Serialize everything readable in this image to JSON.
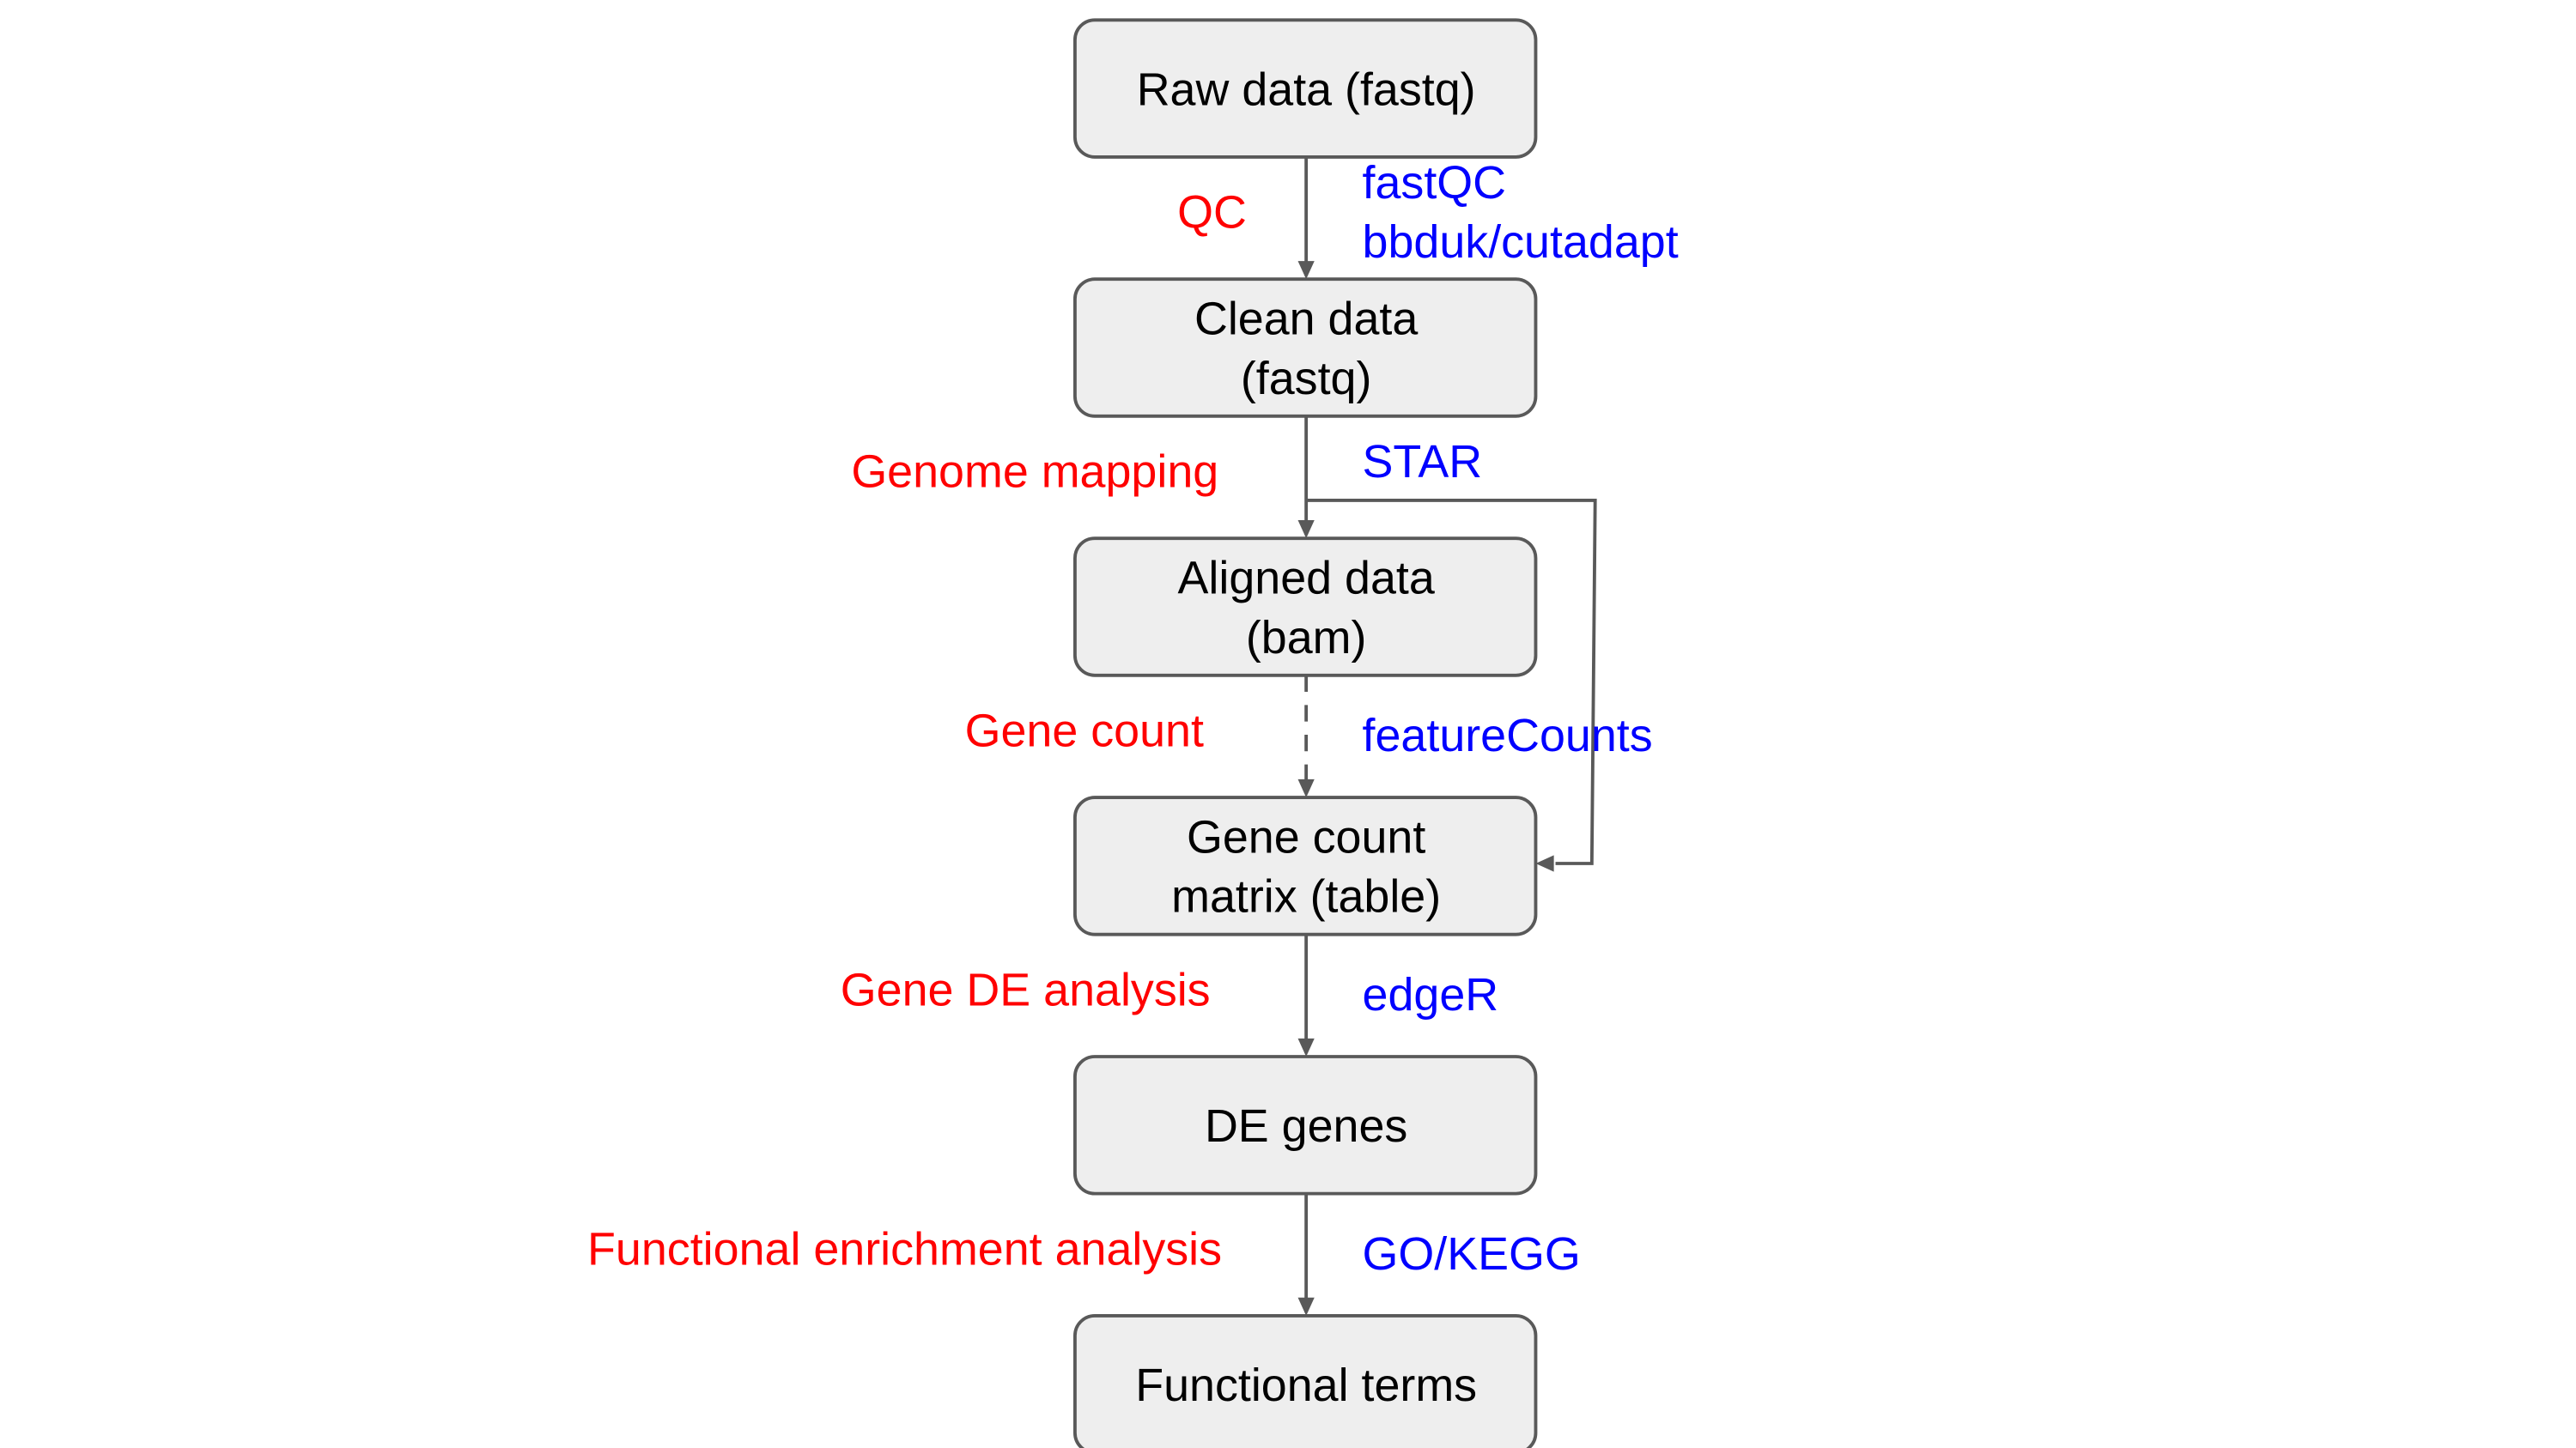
{
  "nodes": [
    {
      "id": "raw",
      "lines": [
        "Raw data (fastq)"
      ]
    },
    {
      "id": "clean",
      "lines": [
        "Clean data",
        "(fastq)"
      ]
    },
    {
      "id": "aligned",
      "lines": [
        "Aligned data",
        "(bam)"
      ]
    },
    {
      "id": "matrix",
      "lines": [
        "Gene count",
        "matrix (table)"
      ]
    },
    {
      "id": "de",
      "lines": [
        "DE genes"
      ]
    },
    {
      "id": "terms",
      "lines": [
        "Functional terms"
      ]
    }
  ],
  "steps": [
    {
      "label": "QC",
      "tools": [
        "fastQC",
        "bbduk/cutadapt"
      ],
      "style": "solid"
    },
    {
      "label": "Genome mapping",
      "tools": [
        "STAR"
      ],
      "style": "solid"
    },
    {
      "label": "Gene count",
      "tools": [
        "featureCounts"
      ],
      "style": "dashed"
    },
    {
      "label": "Gene DE analysis",
      "tools": [
        "edgeR"
      ],
      "style": "solid"
    },
    {
      "label": "Functional enrichment analysis",
      "tools": [
        "GO/KEGG"
      ],
      "style": "solid"
    }
  ],
  "colors": {
    "step": "#ff0000",
    "tool": "#0000ff",
    "box_fill": "#eeeeee",
    "stroke": "#595959"
  }
}
